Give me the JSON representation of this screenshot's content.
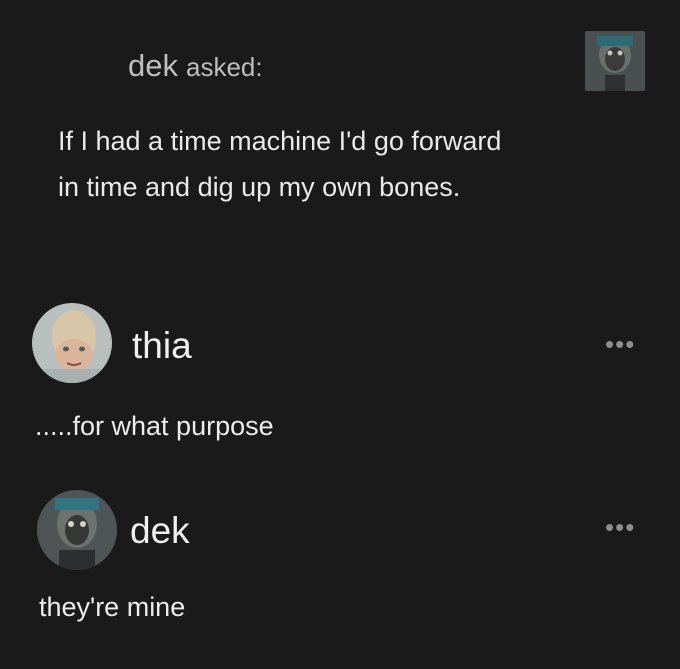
{
  "ask": {
    "asker": "dek",
    "asked_label": "asked:",
    "question": "If I had a time machine I'd go forward in time and dig up my own bones.",
    "avatar_icon": "dek-avatar-icon"
  },
  "replies": [
    {
      "user": "thia",
      "text": ".....for what purpose",
      "avatar_icon": "thia-avatar-icon",
      "more_icon": "more-options-icon",
      "more_label": "•••"
    },
    {
      "user": "dek",
      "text": "they're mine",
      "avatar_icon": "dek-avatar-icon",
      "more_icon": "more-options-icon",
      "more_label": "•••"
    }
  ],
  "colors": {
    "background": "#1a1a1a",
    "primary_text": "#e9e9e9",
    "secondary_text": "#bfbfbf",
    "muted": "#8e8e8e"
  }
}
